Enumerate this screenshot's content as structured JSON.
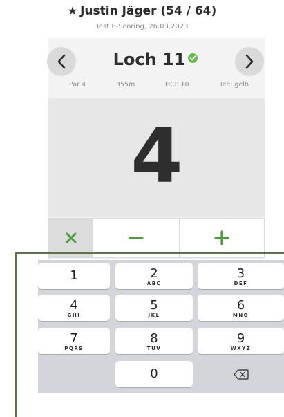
{
  "header": {
    "player_name": "Justin Jäger (54 / 64)",
    "star_icon": "star-icon",
    "subtitle": "Test E-Scoring, 26.03.2023"
  },
  "hole": {
    "title": "Loch 11",
    "status_icon": "check-circle-icon",
    "status_color": "#6aba50",
    "par": "Par 4",
    "distance": "355m",
    "hcp": "HCP 10",
    "tee": "Tee: gelb"
  },
  "navigation": {
    "prev_icon": "chevron-left-icon",
    "next_icon": "chevron-right-icon"
  },
  "score": {
    "value": "4"
  },
  "controls": {
    "clear_icon": "close-icon",
    "minus_icon": "minus-icon",
    "plus_icon": "plus-icon",
    "accent_color": "#4c9a3e"
  },
  "keypad": {
    "keys": [
      {
        "num": "1",
        "letters": ""
      },
      {
        "num": "2",
        "letters": "ABC"
      },
      {
        "num": "3",
        "letters": "DEF"
      },
      {
        "num": "4",
        "letters": "GHI"
      },
      {
        "num": "5",
        "letters": "JKL"
      },
      {
        "num": "6",
        "letters": "MNO"
      },
      {
        "num": "7",
        "letters": "PQRS"
      },
      {
        "num": "8",
        "letters": "TUV"
      },
      {
        "num": "9",
        "letters": "WXYZ"
      },
      {
        "num": "0",
        "letters": ""
      }
    ],
    "delete_icon": "backspace-icon"
  }
}
